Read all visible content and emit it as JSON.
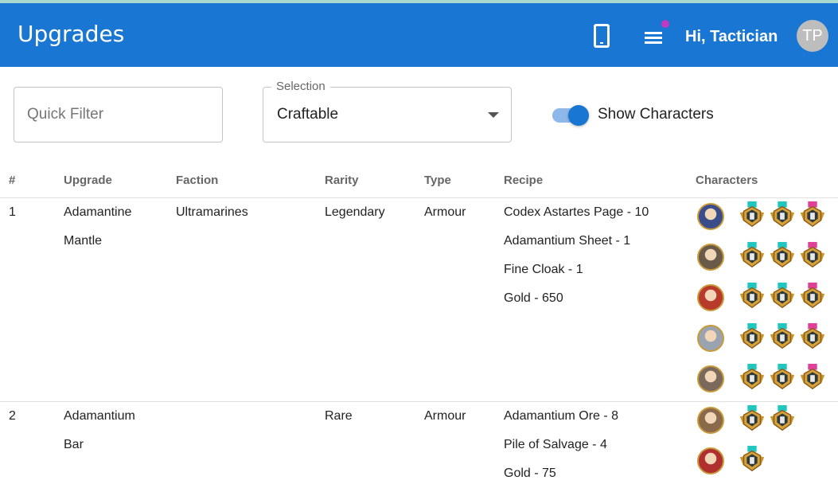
{
  "header": {
    "title": "Upgrades",
    "greeting": "Hi, Tactician",
    "avatar_initials": "TP",
    "accent": "#1976d2",
    "notification_dot_color": "#c238c2"
  },
  "filters": {
    "quick_filter_placeholder": "Quick Filter",
    "quick_filter_value": "",
    "selection_label": "Selection",
    "selection_value": "Craftable",
    "show_characters_label": "Show Characters",
    "show_characters_on": true
  },
  "table": {
    "headers": [
      "#",
      "Upgrade",
      "Faction",
      "Rarity",
      "Type",
      "Recipe",
      "Characters"
    ],
    "rows": [
      {
        "index": "1",
        "upgrade_line1": "Adamantine",
        "upgrade_line2": "Mantle",
        "faction": "Ultramarines",
        "rarity": "Legendary",
        "type": "Armour",
        "recipe": [
          "Codex Astartes Page - 10",
          "Adamantium Sheet - 1",
          "Fine Cloak - 1",
          "Gold - 650"
        ],
        "characters": [
          {
            "portrait_icon": "character-portrait-icon",
            "portrait_color": "#3a4c8a",
            "badges": [
              "rank-badge-icon",
              "rank-badge-icon",
              "rank-badge-icon"
            ]
          },
          {
            "portrait_icon": "character-portrait-icon",
            "portrait_color": "#6a5a4a",
            "badges": [
              "rank-badge-icon",
              "rank-badge-icon",
              "rank-badge-icon"
            ]
          },
          {
            "portrait_icon": "character-portrait-icon",
            "portrait_color": "#b83a2a",
            "badges": [
              "rank-badge-icon",
              "rank-badge-icon",
              "rank-badge-icon"
            ]
          },
          {
            "portrait_icon": "character-portrait-icon",
            "portrait_color": "#9aa4b0",
            "badges": [
              "rank-badge-icon",
              "rank-badge-icon",
              "rank-badge-icon"
            ]
          },
          {
            "portrait_icon": "character-portrait-icon",
            "portrait_color": "#7a6a5c",
            "badges": [
              "rank-badge-icon",
              "rank-badge-icon",
              "rank-badge-icon"
            ]
          }
        ]
      },
      {
        "index": "2",
        "upgrade_line1": "Adamantium",
        "upgrade_line2": "Bar",
        "faction": "",
        "rarity": "Rare",
        "type": "Armour",
        "recipe": [
          "Adamantium Ore - 8",
          "Pile of Salvage - 4",
          "Gold - 75"
        ],
        "characters": [
          {
            "portrait_icon": "character-portrait-icon",
            "portrait_color": "#8a6a4a",
            "badges": [
              "rank-badge-icon",
              "rank-badge-icon"
            ]
          },
          {
            "portrait_icon": "character-portrait-icon",
            "portrait_color": "#b03030",
            "badges": [
              "rank-badge-icon"
            ]
          }
        ]
      }
    ]
  }
}
